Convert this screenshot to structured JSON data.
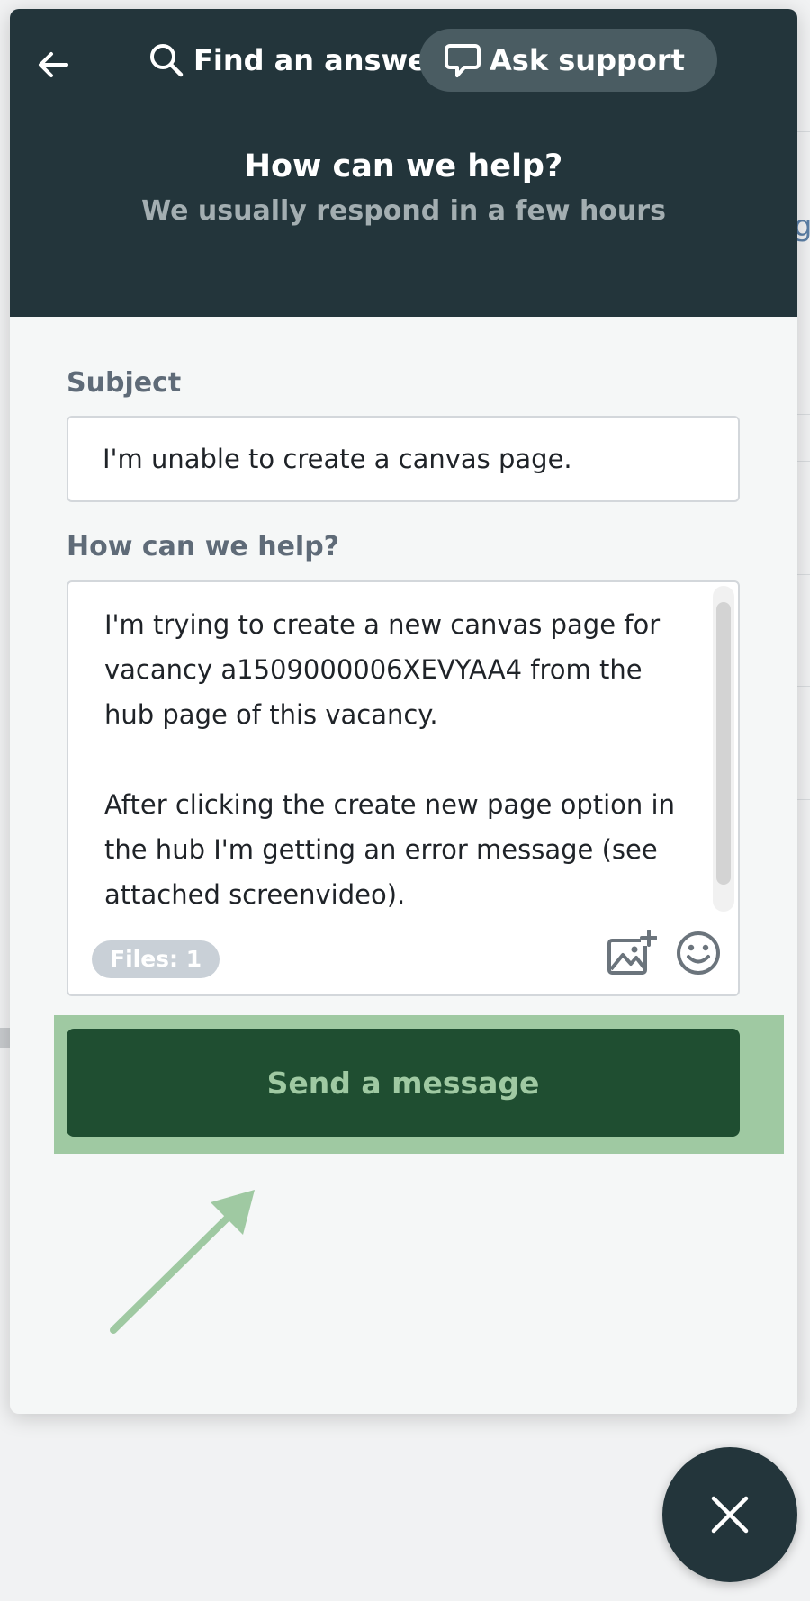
{
  "nav": {
    "find_label": "Find an answer",
    "ask_label": "Ask support"
  },
  "header": {
    "title": "How can we help?",
    "subtitle": "We usually respond in a few hours"
  },
  "form": {
    "subject_label": "Subject",
    "subject_value": "I'm unable to create a canvas page.",
    "help_label": "How can we help?",
    "message_value": "I'm trying to create a new canvas page for vacancy a1509000006XEVYAA4 from the hub page of this vacancy.\n\nAfter clicking the create new page option in the hub I'm getting an error message (see attached screenvideo).",
    "files_badge": "Files: 1",
    "send_label": "Send a message"
  },
  "background": {
    "peek_text": "g"
  },
  "colors": {
    "header_bg": "#23353b",
    "active_tab_bg": "#4a5c62",
    "send_button_bg": "#1f4e31",
    "highlight": "#9fc9a2"
  },
  "icons": [
    "back-arrow-icon",
    "search-icon",
    "chat-bubble-icon",
    "add-image-icon",
    "emoji-icon",
    "close-icon"
  ]
}
